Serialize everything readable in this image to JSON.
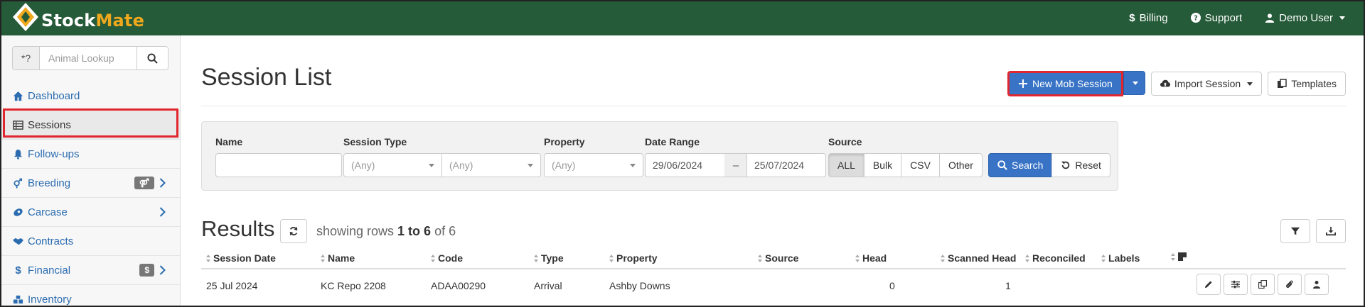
{
  "header": {
    "logo_text_a": "Stock",
    "logo_text_b": "Mate",
    "nav": [
      {
        "label": "Billing",
        "icon": "dollar-icon"
      },
      {
        "label": "Support",
        "icon": "question-circle-icon"
      },
      {
        "label": "Demo User",
        "icon": "user-icon"
      }
    ]
  },
  "sidebar": {
    "lookup_addon": "*?",
    "lookup_placeholder": "Animal Lookup",
    "items": [
      {
        "label": "Dashboard",
        "icon": "home-icon"
      },
      {
        "label": "Sessions",
        "icon": "table-icon"
      },
      {
        "label": "Follow-ups",
        "icon": "bell-icon"
      },
      {
        "label": "Breeding",
        "icon": "gender-icon",
        "badge": "⚤"
      },
      {
        "label": "Carcase",
        "icon": "carcase-icon"
      },
      {
        "label": "Contracts",
        "icon": "handshake-icon"
      },
      {
        "label": "Financial",
        "icon": "dollar-icon",
        "badge": "$"
      },
      {
        "label": "Inventory",
        "icon": "boxes-icon"
      }
    ]
  },
  "page": {
    "title": "Session List",
    "new_session": "New Mob Session",
    "import_session": "Import Session",
    "templates": "Templates"
  },
  "filter": {
    "name_label": "Name",
    "name_value": "",
    "session_type_label": "Session Type",
    "session_type_1": "(Any)",
    "session_type_2": "(Any)",
    "property_label": "Property",
    "property_value": "(Any)",
    "date_range_label": "Date Range",
    "date_from": "29/06/2024",
    "date_sep": "–",
    "date_to": "25/07/2024",
    "source_label": "Source",
    "sources": [
      "ALL",
      "Bulk",
      "CSV",
      "Other"
    ],
    "search": "Search",
    "reset": "Reset"
  },
  "results": {
    "title": "Results",
    "showing_prefix": "showing rows ",
    "showing_range": "1 to 6",
    "showing_suffix": " of 6",
    "columns": [
      "Session Date",
      "Name",
      "Code",
      "Type",
      "Property",
      "Source",
      "Head",
      "Scanned Head",
      "Reconciled",
      "Labels"
    ],
    "rows": [
      {
        "date": "25 Jul 2024",
        "name": "KC Repo 2208",
        "code": "ADAA00290",
        "type": "Arrival",
        "property": "Ashby Downs",
        "source": "",
        "head": "0",
        "scanned": "1",
        "reconciled": "",
        "labels": ""
      }
    ]
  }
}
